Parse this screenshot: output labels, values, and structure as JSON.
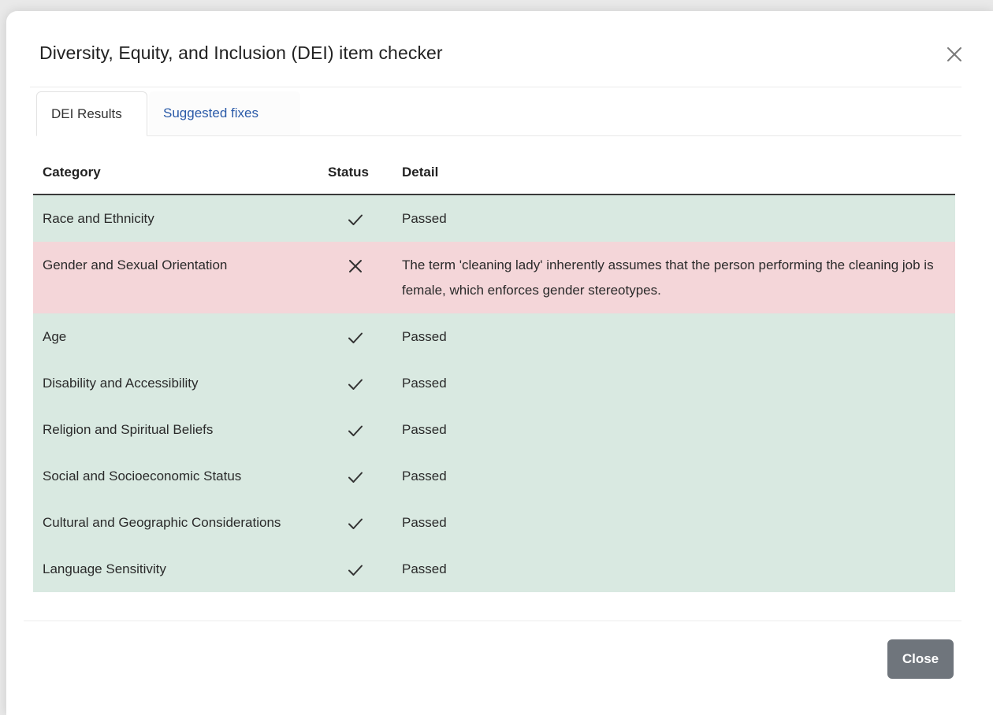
{
  "dialog": {
    "title": "Diversity, Equity, and Inclusion (DEI) item checker",
    "close_icon": "close-icon"
  },
  "tabs": [
    {
      "label": "DEI Results",
      "active": true
    },
    {
      "label": "Suggested fixes",
      "active": false
    }
  ],
  "table": {
    "headers": {
      "category": "Category",
      "status": "Status",
      "detail": "Detail"
    },
    "rows": [
      {
        "category": "Race and Ethnicity",
        "status": "pass",
        "status_icon": "check-icon",
        "detail": "Passed"
      },
      {
        "category": "Gender and Sexual Orientation",
        "status": "fail",
        "status_icon": "x-icon",
        "detail": "The term 'cleaning lady' inherently assumes that the person performing the cleaning job is female, which enforces gender stereotypes."
      },
      {
        "category": "Age",
        "status": "pass",
        "status_icon": "check-icon",
        "detail": "Passed"
      },
      {
        "category": "Disability and Accessibility",
        "status": "pass",
        "status_icon": "check-icon",
        "detail": "Passed"
      },
      {
        "category": "Religion and Spiritual Beliefs",
        "status": "pass",
        "status_icon": "check-icon",
        "detail": "Passed"
      },
      {
        "category": "Social and Socioeconomic Status",
        "status": "pass",
        "status_icon": "check-icon",
        "detail": "Passed"
      },
      {
        "category": "Cultural and Geographic Considerations",
        "status": "pass",
        "status_icon": "check-icon",
        "detail": "Passed"
      },
      {
        "category": "Language Sensitivity",
        "status": "pass",
        "status_icon": "check-icon",
        "detail": "Passed"
      }
    ]
  },
  "footer": {
    "close_label": "Close"
  },
  "colors": {
    "pass_row": "#d9e9e1",
    "fail_row": "#f4d6d9",
    "tab_link": "#2a5aa8",
    "close_button": "#6f757c"
  }
}
